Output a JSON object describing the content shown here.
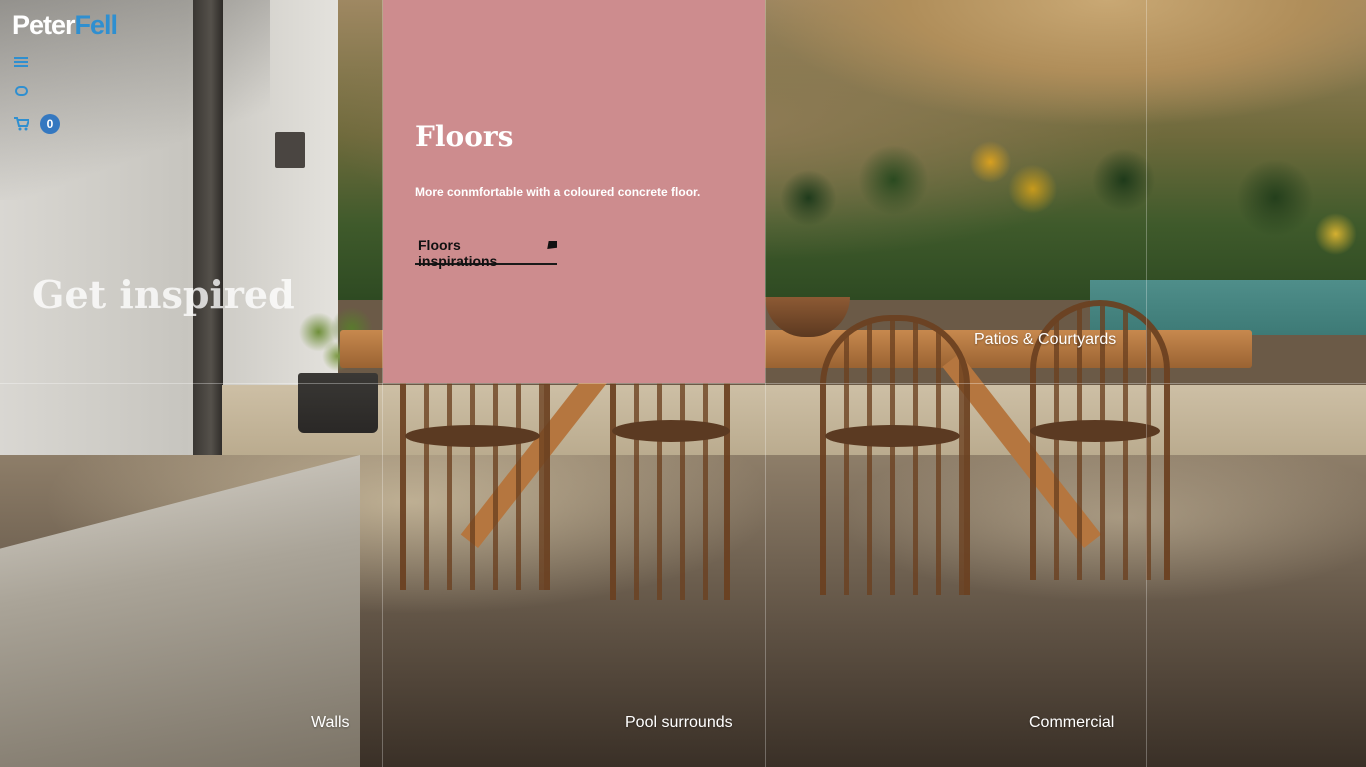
{
  "brand": {
    "part1": "Peter",
    "part2": "Fell"
  },
  "sidebar": {
    "menu_icon": "hamburger-menu-icon",
    "chat_icon": "chat-bubble-icon",
    "cart_icon": "shopping-cart-icon",
    "cart_count": "0"
  },
  "hero": {
    "title": "Get inspired"
  },
  "feature": {
    "title": "Floors",
    "description": "More conmfortable with a coloured concrete floor.",
    "link_label": "Floors inspirations",
    "link_icon": "arrow-icon",
    "background": "#cd8c8e"
  },
  "tiles": {
    "patios": "Patios & Courtyards",
    "walls": "Walls",
    "pool": "Pool surrounds",
    "commercial": "Commercial"
  },
  "colors": {
    "accent": "#2f8fd0",
    "badge": "#3578c0"
  }
}
